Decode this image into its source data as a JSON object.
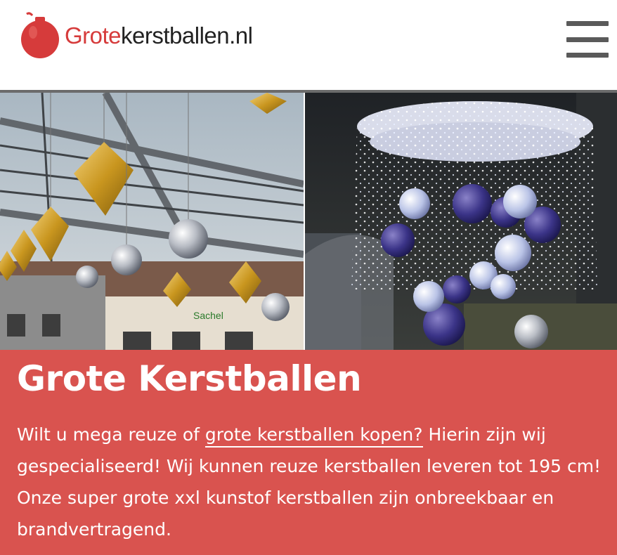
{
  "brand": {
    "logo_prefix": "Grote",
    "logo_suffix": "kerstballen.nl",
    "accent_color": "#d63b3b"
  },
  "nav": {
    "menu_icon": "hamburger-menu-icon"
  },
  "hero": {
    "left_image": "shopping-street-hanging-ornaments",
    "right_image": "illuminated-ornament-chandelier"
  },
  "intro": {
    "title": "Grote Kerstballen",
    "text_before_link": "Wilt u mega reuze of ",
    "link_text": "grote kerstballen kopen?",
    "text_after_link": " Hierin zijn wij gespecialiseerd! Wij kunnen reuze kerstballen leveren tot 195 cm! Onze super grote xxl kunstof kerstballen zijn onbreekbaar en brandvertragend.",
    "background_color": "#d9534f"
  }
}
